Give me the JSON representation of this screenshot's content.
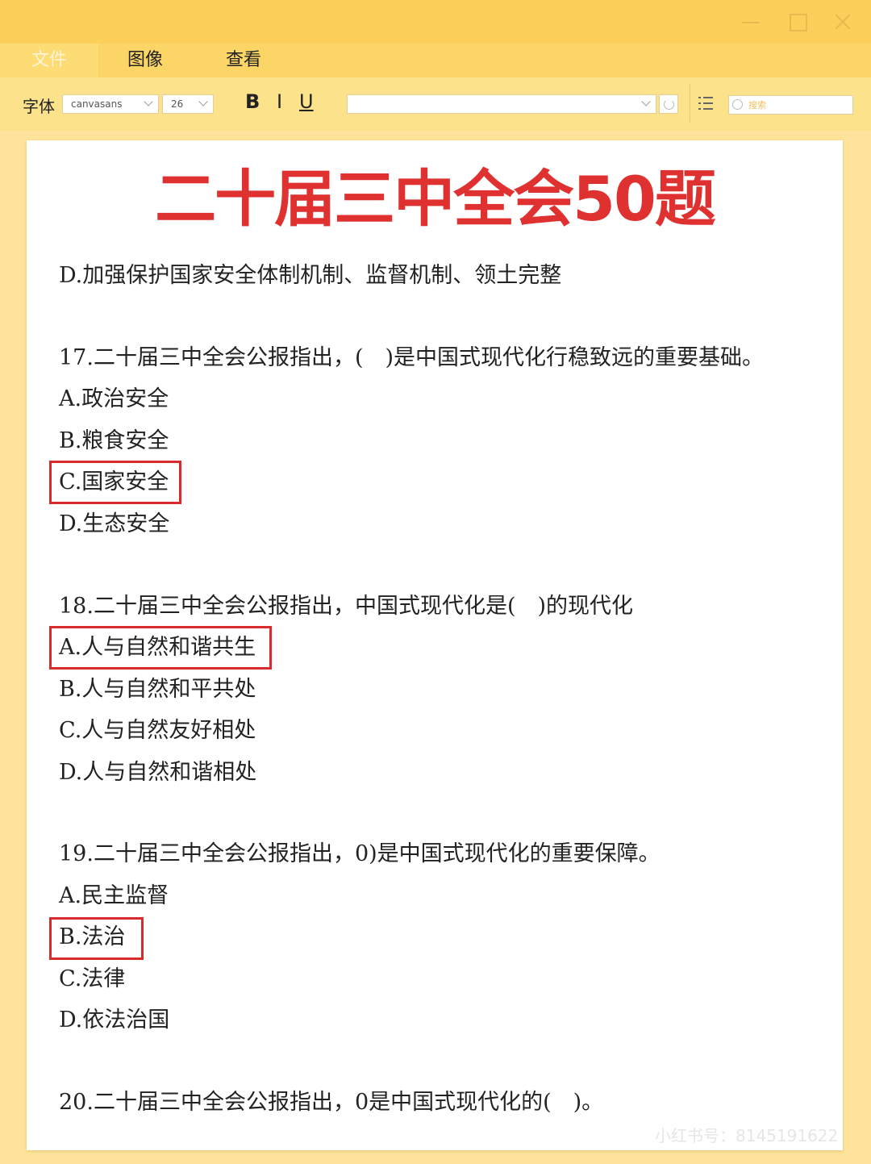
{
  "menu": {
    "file": "文件",
    "image": "图像",
    "view": "查看"
  },
  "toolbar": {
    "font_label": "字体",
    "font_value": "canvasans",
    "size_value": "26",
    "bold": "B",
    "italic": "I",
    "underline": "U",
    "search_placeholder": "搜索"
  },
  "document": {
    "title": "二十届三中全会50题",
    "prev_option": "D.加强保护国家安全体制机制、监督机制、领土完整",
    "q17": {
      "question": "17.二十届三中全会公报指出，(　)是中国式现代化行稳致远的重要基础。",
      "a": "A.政治安全",
      "b": "B.粮食安全",
      "c": "C.国家安全",
      "d": "D.生态安全"
    },
    "q18": {
      "question": "18.二十届三中全会公报指出，中国式现代化是(　)的现代化",
      "a": "A.人与自然和谐共生",
      "b": "B.人与自然和平共处",
      "c": "C.人与自然友好相处",
      "d": "D.人与自然和谐相处"
    },
    "q19": {
      "question": "19.二十届三中全会公报指出，0)是中国式现代化的重要保障。",
      "a": "A.民主监督",
      "b": "B.法治",
      "c": "C.法律",
      "d": "D.依法治国"
    },
    "q20": {
      "question": "20.二十届三中全会公报指出，0是中国式现代化的(　)。"
    }
  },
  "watermark": "小红书号：8145191622",
  "colors": {
    "title_red": "#e03131",
    "answer_box": "#d92b2b",
    "titlebar": "#fbcf5a",
    "toolbar": "#fde28c"
  }
}
